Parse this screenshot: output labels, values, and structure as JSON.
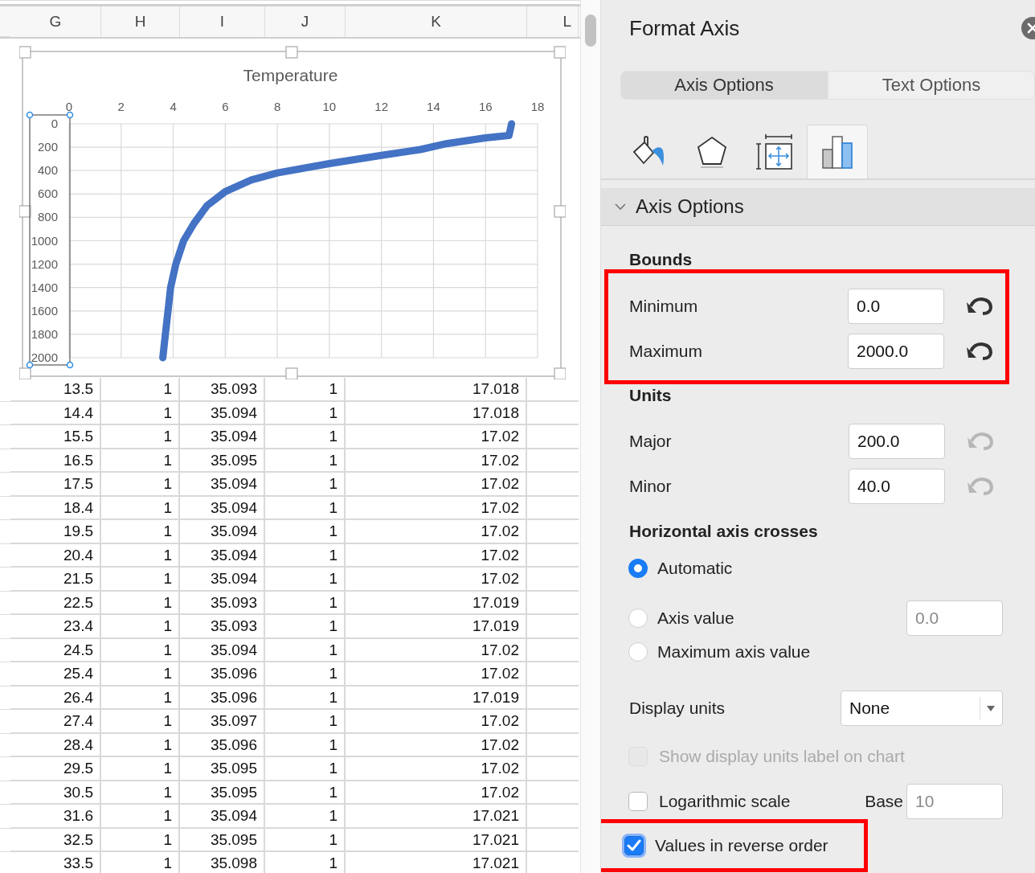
{
  "sheet": {
    "columns": [
      "G",
      "H",
      "I",
      "J",
      "K",
      "L"
    ],
    "rows": [
      [
        "13.5",
        "1",
        "35.093",
        "1",
        "17.018"
      ],
      [
        "14.4",
        "1",
        "35.094",
        "1",
        "17.018"
      ],
      [
        "15.5",
        "1",
        "35.094",
        "1",
        "17.02"
      ],
      [
        "16.5",
        "1",
        "35.095",
        "1",
        "17.02"
      ],
      [
        "17.5",
        "1",
        "35.094",
        "1",
        "17.02"
      ],
      [
        "18.4",
        "1",
        "35.094",
        "1",
        "17.02"
      ],
      [
        "19.5",
        "1",
        "35.094",
        "1",
        "17.02"
      ],
      [
        "20.4",
        "1",
        "35.094",
        "1",
        "17.02"
      ],
      [
        "21.5",
        "1",
        "35.094",
        "1",
        "17.02"
      ],
      [
        "22.5",
        "1",
        "35.093",
        "1",
        "17.019"
      ],
      [
        "23.4",
        "1",
        "35.093",
        "1",
        "17.019"
      ],
      [
        "24.5",
        "1",
        "35.094",
        "1",
        "17.02"
      ],
      [
        "25.4",
        "1",
        "35.096",
        "1",
        "17.02"
      ],
      [
        "26.4",
        "1",
        "35.096",
        "1",
        "17.019"
      ],
      [
        "27.4",
        "1",
        "35.097",
        "1",
        "17.02"
      ],
      [
        "28.4",
        "1",
        "35.096",
        "1",
        "17.02"
      ],
      [
        "29.5",
        "1",
        "35.095",
        "1",
        "17.02"
      ],
      [
        "30.5",
        "1",
        "35.095",
        "1",
        "17.02"
      ],
      [
        "31.6",
        "1",
        "35.094",
        "1",
        "17.021"
      ],
      [
        "32.5",
        "1",
        "35.095",
        "1",
        "17.021"
      ],
      [
        "33.5",
        "1",
        "35.098",
        "1",
        "17.021"
      ]
    ]
  },
  "chart": {
    "selected": true,
    "axis_selected": true,
    "chart_data": {
      "type": "line",
      "title": "Temperature",
      "x": [
        3.6,
        3.7,
        3.8,
        3.9,
        4.1,
        4.4,
        4.8,
        5.3,
        6.0,
        7.0,
        8.0,
        10.0,
        12.0,
        13.5,
        14.5,
        16.0,
        16.9,
        17.0
      ],
      "series": [
        {
          "color": "#4472c4",
          "values": [
            2000,
            1800,
            1600,
            1400,
            1200,
            1000,
            850,
            700,
            580,
            480,
            420,
            340,
            270,
            220,
            170,
            120,
            100,
            0
          ]
        }
      ],
      "xlim": [
        0,
        18
      ],
      "ylim": [
        2000,
        0
      ],
      "grid": true,
      "xticks": [
        0,
        2,
        4,
        6,
        8,
        10,
        12,
        14,
        16,
        18
      ],
      "yticks": [
        0,
        200,
        400,
        600,
        800,
        1000,
        1200,
        1400,
        1600,
        1800,
        2000
      ]
    }
  },
  "panel": {
    "title": "Format Axis",
    "tabs": [
      {
        "label": "Axis Options",
        "selected": true
      },
      {
        "label": "Text Options",
        "selected": false
      }
    ],
    "icon_tabs": [
      {
        "kind": "fill",
        "selected": false
      },
      {
        "kind": "effects",
        "selected": false
      },
      {
        "kind": "size",
        "selected": false
      },
      {
        "kind": "options",
        "selected": true
      }
    ],
    "section": {
      "title": "Axis Options",
      "expanded": true
    },
    "bounds": {
      "heading": "Bounds",
      "highlighted": true,
      "fields": [
        {
          "label": "Minimum",
          "value": "0.0",
          "reset_enabled": true
        },
        {
          "label": "Maximum",
          "value": "2000.0",
          "reset_enabled": true
        }
      ]
    },
    "units": {
      "heading": "Units",
      "fields": [
        {
          "label": "Major",
          "value": "200.0",
          "reset_enabled": false
        },
        {
          "label": "Minor",
          "value": "40.0",
          "reset_enabled": false
        }
      ]
    },
    "crosses": {
      "heading": "Horizontal axis crosses",
      "options": [
        {
          "label": "Automatic",
          "selected": true
        },
        {
          "label": "Axis value",
          "selected": false,
          "field": {
            "value": "0.0",
            "disabled": true
          }
        },
        {
          "label": "Maximum axis value",
          "selected": false
        }
      ]
    },
    "display_units": {
      "label": "Display units",
      "value": "None"
    },
    "checks": [
      {
        "label": "Show display units label on chart",
        "checked": false,
        "disabled": true
      },
      {
        "label": "Logarithmic scale",
        "checked": false,
        "disabled": false,
        "base": {
          "label": "Base",
          "value": "10",
          "disabled": true
        }
      },
      {
        "label": "Values in reverse order",
        "checked": true,
        "disabled": false,
        "highlighted": true
      }
    ]
  }
}
